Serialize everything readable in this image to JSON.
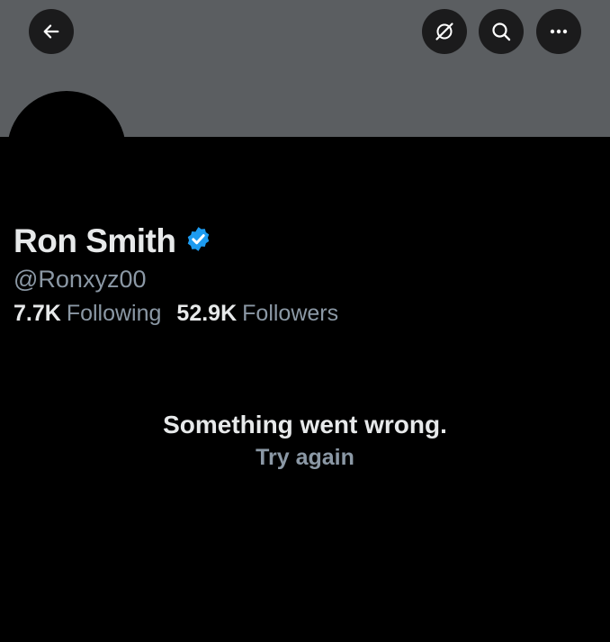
{
  "header": {
    "back_icon": "arrow-left-icon",
    "grok_icon": "grok-icon",
    "search_icon": "search-icon",
    "more_icon": "ellipsis-icon"
  },
  "profile": {
    "display_name": "Ron Smith",
    "verified_icon": "verified-badge-icon",
    "handle": "@Ronxyz00",
    "following_count": "7.7K",
    "following_label": "Following",
    "followers_count": "52.9K",
    "followers_label": "Followers"
  },
  "error": {
    "message": "Something went wrong.",
    "retry_label": "Try again"
  },
  "colors": {
    "banner": "#5b5e61",
    "background": "#000000",
    "verified": "#1d9bf0",
    "primary_text": "#e7e9ea",
    "secondary_text": "#8b98a5"
  }
}
